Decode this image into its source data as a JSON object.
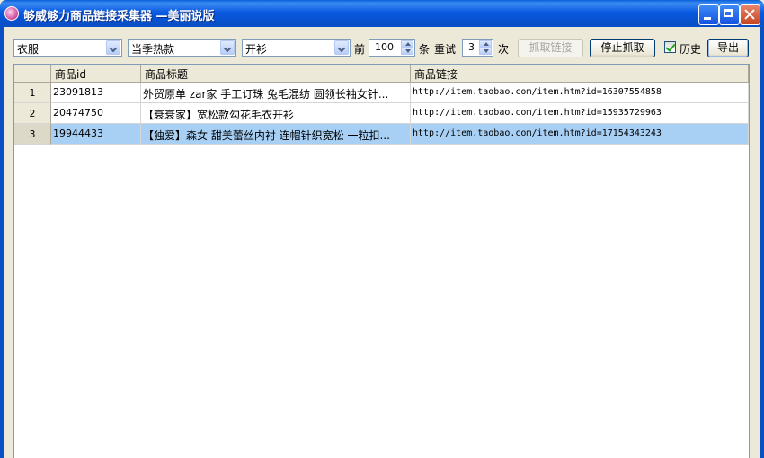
{
  "window": {
    "title": "够威够力商品链接采集器 —美丽说版",
    "icon": "app-logo-icon"
  },
  "toolbar": {
    "category1": "衣服",
    "category2": "当季热款",
    "category3": "开衫",
    "label_top": "前",
    "top_count": "100",
    "label_items": "条",
    "label_retry": "重试",
    "retry_count": "3",
    "label_times": "次",
    "fetch_button": "抓取链接",
    "stop_button": "停止抓取",
    "history_checkbox_label": "历史",
    "history_checked": true,
    "export_button": "导出"
  },
  "table": {
    "columns": [
      "商品id",
      "商品标题",
      "商品链接"
    ],
    "rows": [
      {
        "num": "1",
        "id": "23091813",
        "title": "外贸原单 zar家 手工订珠 兔毛混纺 圆领长袖女针...",
        "link": "http://item.taobao.com/item.htm?id=16307554858",
        "selected": false
      },
      {
        "num": "2",
        "id": "20474750",
        "title": "【衰衰家】宽松款勾花毛衣开衫",
        "link": "http://item.taobao.com/item.htm?id=15935729963",
        "selected": false
      },
      {
        "num": "3",
        "id": "19944433",
        "title": "【独爱】森女 甜美蕾丝内衬 连帽针织宽松 一粒扣...",
        "link": "http://item.taobao.com/item.htm?id=17154343243",
        "selected": true
      }
    ]
  },
  "colors": {
    "titlebar": "#0a5ae0",
    "selection": "#a8d0f5",
    "face": "#ece9d8"
  }
}
